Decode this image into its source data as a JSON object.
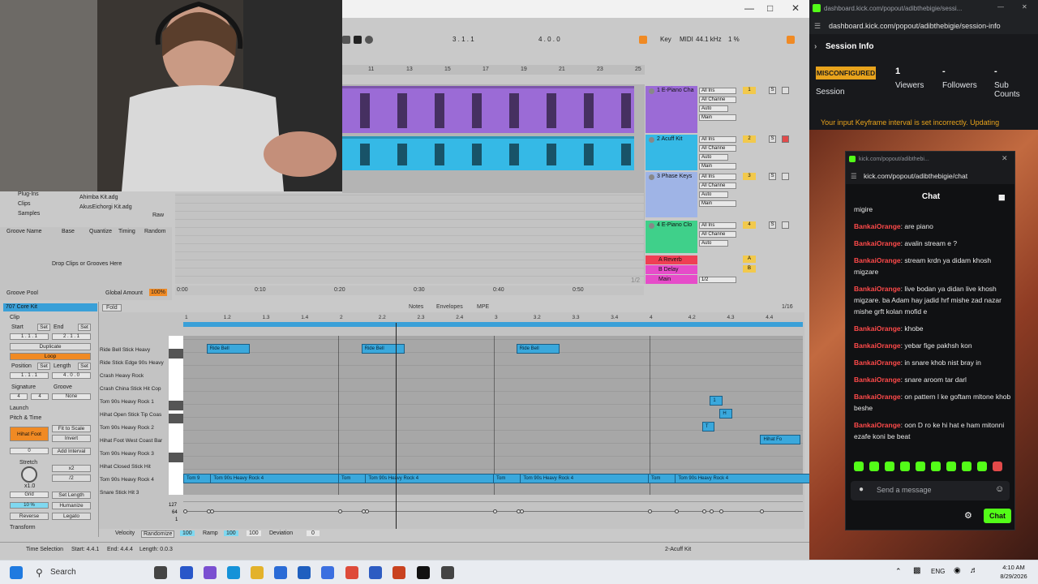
{
  "ableton": {
    "transport": {
      "position": "3 . 1 . 1",
      "loop_length": "4 . 0 . 0",
      "key_label": "Key",
      "midi_label": "MIDI",
      "sample_rate": "44.1 kHz",
      "cpu": "1 %"
    },
    "arrangement_ruler": [
      "11",
      "13",
      "15",
      "17",
      "19",
      "21",
      "23",
      "25"
    ],
    "tracks": [
      {
        "name": "1 E-Piano Cha",
        "num": "1",
        "input": "All Ins",
        "channel": "All Channe",
        "color": "#9b6bd6"
      },
      {
        "name": "2 Acuff Kit",
        "num": "2",
        "input": "All Ins",
        "channel": "All Channe",
        "color": "#35b9e6"
      },
      {
        "name": "3 Phase Keys",
        "num": "3",
        "input": "All Ins",
        "channel": "All Channe",
        "color": "#9fb4e6"
      },
      {
        "name": "4 E-Piano Clo",
        "num": "4",
        "input": "All Ins",
        "channel": "All Channe",
        "color": "#3fd08a"
      }
    ],
    "track_buttons": {
      "in": "In",
      "auto": "Auto",
      "off": "Off",
      "main": "Main",
      "s": "S"
    },
    "returns": [
      {
        "name": "A Reverb",
        "letter": "A",
        "color": "#ef3f54"
      },
      {
        "name": "B Delay",
        "letter": "B",
        "color": "#e64cc9"
      },
      {
        "name": "Main",
        "letter": "",
        "color": "#e64cc9"
      }
    ],
    "main_select": "1/2",
    "page_indicator": "1/2",
    "bottom_ruler": [
      "0:00",
      "0:10",
      "0:20",
      "0:30",
      "0:40",
      "0:50"
    ],
    "browser": {
      "items": [
        "Plug-Ins",
        "Clips",
        "Samples"
      ],
      "files": [
        "Ahimba Kit.adg",
        "AkusEichorgi Kit.adg"
      ],
      "raw_label": "Raw"
    },
    "groove_pool": {
      "columns": [
        "Groove Name",
        "Base",
        "Quantize",
        "Timing",
        "Random"
      ],
      "placeholder": "Drop Clips or Grooves Here",
      "title": "Groove Pool",
      "global_amount_label": "Global Amount",
      "global_amount_value": "100%"
    },
    "clip_panel": {
      "title": "707 Core Kit",
      "section_clip": "Clip",
      "start_label": "Start",
      "end_label": "End",
      "set_label": "Set",
      "start_value": "1 . 1 . 1",
      "end_value": "2 . 1 . 1",
      "duplicate_label": "Duplicate",
      "loop_label": "Loop",
      "position_label": "Position",
      "length_label": "Length",
      "position_value": "1 . 1 . 1",
      "length_value": "4 . 0 . 0",
      "signature_label": "Signature",
      "groove_label": "Groove",
      "sig_num": "4",
      "sig_den": "4",
      "groove_value": "None",
      "launch_label": "Launch",
      "pitch_time_label": "Pitch & Time",
      "note_label": "Hihat Foot",
      "fit_to_scale": "Fit to Scale",
      "invert": "Invert",
      "add_interval": "Add Interval",
      "stretch_label": "Stretch",
      "stretch_value": "x1.0",
      "mult2": "x2",
      "div2": "/2",
      "grid_label": "Grid",
      "set_length": "Set Length",
      "humanize": "Humanize",
      "humanize_pct": "10 %",
      "reverse": "Reverse",
      "legato": "Legato",
      "transform": "Transform",
      "zero_value": "0"
    },
    "midi_editor": {
      "fold_label": "Fold",
      "tabs": [
        "Notes",
        "Envelopes",
        "MPE"
      ],
      "grid_value": "1/16",
      "ruler": [
        "1",
        "1.2",
        "1.3",
        "1.4",
        "2",
        "2.2",
        "2.3",
        "2.4",
        "3",
        "3.2",
        "3.3",
        "3.4",
        "4",
        "4.2",
        "4.3",
        "4.4"
      ],
      "lanes": [
        "Ride Bell Stick Heavy",
        "Ride Stick Edge 90s Heavy",
        "Crash Heavy Rock",
        "Crash China Stick Hit Cop",
        "Tom 90s Heavy Rock 1",
        "Hihat Open Stick Tip Coas",
        "Tom 90s Heavy Rock 2",
        "Hihat Foot West Coast Bar",
        "Tom 90s Heavy Rock 3",
        "Hihat Closed Stick Hit",
        "Tom 90s Heavy Rock 4",
        "Snare Stick Hit 3"
      ],
      "notes": [
        {
          "text": "Ride Bell",
          "beat": 0.6,
          "len": 0.28,
          "lane": 0
        },
        {
          "text": "Ride Bell",
          "beat": 4.6,
          "len": 0.28,
          "lane": 0
        },
        {
          "text": "Ride Bell",
          "beat": 8.6,
          "len": 0.28,
          "lane": 0
        },
        {
          "text": "1",
          "beat": 13.6,
          "len": 0.08,
          "lane": 4
        },
        {
          "text": "H",
          "beat": 13.85,
          "len": 0.08,
          "lane": 5
        },
        {
          "text": "T",
          "beat": 13.4,
          "len": 0.08,
          "lane": 6
        },
        {
          "text": "Hihat Fo",
          "beat": 14.9,
          "len": 0.26,
          "lane": 7
        },
        {
          "text": "Tom 9",
          "beat": 0.0,
          "len": 0.18,
          "lane": 10
        },
        {
          "text": "Tom 90s Heavy Rock 4",
          "beat": 0.7,
          "len": 1.4,
          "lane": 10
        },
        {
          "text": "Tom",
          "beat": 4.0,
          "len": 0.2,
          "lane": 10
        },
        {
          "text": "Tom 90s Heavy Rock 4",
          "beat": 4.7,
          "len": 1.4,
          "lane": 10
        },
        {
          "text": "Tom",
          "beat": 8.0,
          "len": 0.2,
          "lane": 10
        },
        {
          "text": "Tom 90s Heavy Rock 4",
          "beat": 8.7,
          "len": 1.4,
          "lane": 10
        },
        {
          "text": "Tom",
          "beat": 12.0,
          "len": 0.2,
          "lane": 10
        },
        {
          "text": "Tom 90s Heavy Rock 4",
          "beat": 12.7,
          "len": 1.4,
          "lane": 10
        }
      ],
      "velocity_scale": [
        "127",
        "64",
        "1"
      ],
      "velocity_label": "Velocity",
      "randomize_label": "Randomize",
      "randomize_value": "100",
      "ramp_label": "Ramp",
      "ramp_values": [
        "100",
        "100"
      ],
      "deviation_label": "Deviation",
      "deviation_value": "0"
    },
    "status": {
      "selection": "Time Selection",
      "start": "Start: 4.4.1",
      "end": "End: 4.4.4",
      "length": "Length: 0.0.3",
      "track_label": "2-Acuff Kit"
    }
  },
  "kick": {
    "tab_url": "dashboard.kick.com/popout/adibthebigie/sessi...",
    "url": "dashboard.kick.com/popout/adibthebigie/session-info",
    "session_title": "Session Info",
    "status_badge": "MISCONFIGURED",
    "session_label": "Session",
    "viewers_value": "1",
    "viewers_label": "Viewers",
    "followers_value": "-",
    "followers_label": "Followers",
    "subs_value": "-",
    "subs_label": "Sub Counts",
    "warning": "Your input Keyframe interval is set incorrectly. Updating"
  },
  "chat": {
    "title_url": "kick.com/popout/adibthebi...",
    "url": "kick.com/popout/adibthebigie/chat",
    "header": "Chat",
    "partial_top": "migire",
    "messages": [
      {
        "user": "BankaiOrange",
        "text": "are piano"
      },
      {
        "user": "BankaiOrange",
        "text": "avalin stream e ?"
      },
      {
        "user": "BankaiOrange",
        "text": "stream krdn ya didam khosh migzare"
      },
      {
        "user": "BankaiOrange",
        "text": "live bodan ya didan live khosh migzare. ba Adam hay jadid hrf mishe zad nazar mishe grft kolan mofid e"
      },
      {
        "user": "BankaiOrange",
        "text": "khobe"
      },
      {
        "user": "BankaiOrange",
        "text": "yebar fige pakhsh kon"
      },
      {
        "user": "BankaiOrange",
        "text": "in snare khob nist bray in"
      },
      {
        "user": "BankaiOrange",
        "text": "snare aroom tar darl"
      },
      {
        "user": "BankaiOrange",
        "text": "on pattern l ke goftam mltone khob beshe"
      },
      {
        "user": "BankaiOrange",
        "text": "oon D ro ke hi hat e ham mitonni ezafe koni be beat"
      }
    ],
    "input_placeholder": "Send a message",
    "send_label": "Chat",
    "accent": "#53fc18"
  },
  "taskbar": {
    "search_label": "Search",
    "lang": "ENG",
    "time": "4:10 AM",
    "date": "8/29/2026"
  }
}
